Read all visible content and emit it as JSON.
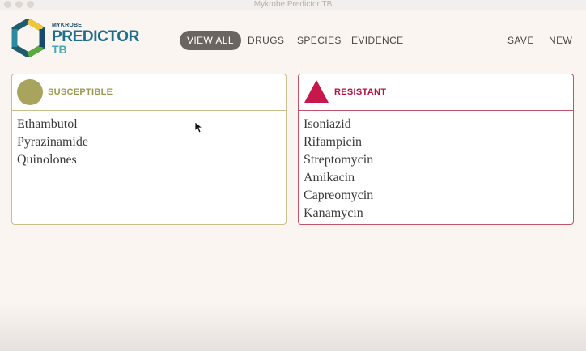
{
  "window": {
    "title": "Mykrobe Predictor TB"
  },
  "brand": {
    "top": "MYKROBE",
    "main": "PREDICTOR",
    "sub": "TB"
  },
  "nav": {
    "view_all": "VIEW ALL",
    "drugs": "DRUGS",
    "species": "SPECIES",
    "evidence": "EVIDENCE",
    "save": "SAVE",
    "new": "NEW"
  },
  "susceptible": {
    "label": "SUSCEPTIBLE",
    "icon": "circle-icon",
    "color": "#a8a45d",
    "drugs": [
      "Ethambutol",
      "Pyrazinamide",
      "Quinolones"
    ]
  },
  "resistant": {
    "label": "RESISTANT",
    "icon": "triangle-icon",
    "color": "#c8174a",
    "drugs": [
      "Isoniazid",
      "Rifampicin",
      "Streptomycin",
      "Amikacin",
      "Capreomycin",
      "Kanamycin"
    ]
  }
}
